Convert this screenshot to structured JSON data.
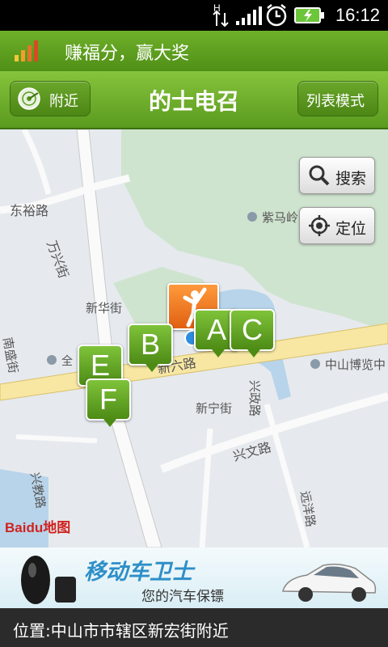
{
  "status_bar": {
    "time": "16:12",
    "network_label": "H"
  },
  "promo_banner": {
    "text": "赚福分，赢大奖"
  },
  "header": {
    "title": "的士电召",
    "nearby_button": "附近",
    "list_mode_button": "列表模式"
  },
  "map": {
    "search_button": "搜索",
    "locate_button": "定位",
    "road_labels": [
      "东裕路",
      "万兴街",
      "新华街",
      "南盛街",
      "新六路",
      "新宁街",
      "兴政路",
      "兴文路",
      "兴教路",
      "远洋路",
      "紫马岭",
      "中山博览中",
      "全"
    ],
    "taxi_markers": [
      "A",
      "B",
      "C",
      "E",
      "F"
    ],
    "logo": "Baidu地图"
  },
  "ad": {
    "title": "移动车卫士",
    "subtitle": "您的汽车保镖"
  },
  "location_bar": {
    "text": "位置:中山市市辖区新宏街附近"
  },
  "colors": {
    "header_green": "#5a9a1e",
    "marker_green": "#4d8b15",
    "user_marker_orange": "#f07a1a",
    "ad_blue": "#2e8fc8"
  }
}
